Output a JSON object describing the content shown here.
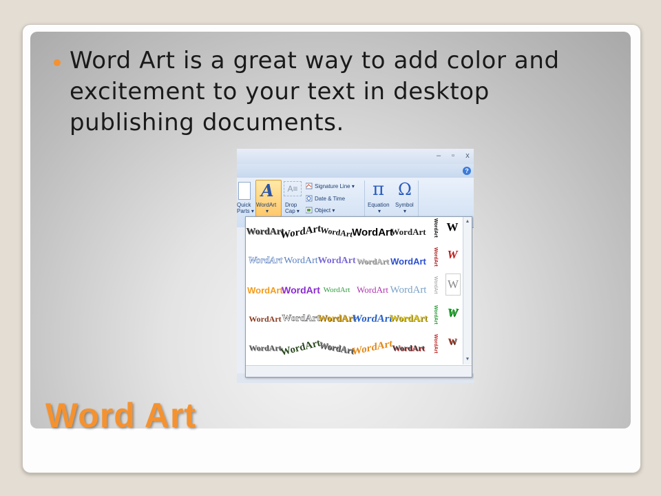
{
  "slide": {
    "bullet_text": "Word Art is a great way to add color and excitement to your text in desktop publishing documents.",
    "title": "Word Art"
  },
  "window": {
    "minimize": "–",
    "restore": "▫",
    "close": "x",
    "help": "?"
  },
  "ribbon": {
    "quick_parts_line1": "Quick",
    "quick_parts_line2": "Parts ▾",
    "wordart_label": "WordArt",
    "wordart_arrow": "▾",
    "wordart_glyph": "A",
    "dropcap_line1": "Drop",
    "dropcap_line2": "Cap ▾",
    "dropcap_glyph": "A≡",
    "signature_line": "Signature Line ▾",
    "date_time": "Date & Time",
    "object": "Object ▾",
    "equation_glyph": "π",
    "equation_label": "Equation",
    "equation_arrow": "▾",
    "symbol_glyph": "Ω",
    "symbol_label": "Symbol",
    "symbol_arrow": "▾"
  },
  "gallery": {
    "sample": "WordArt",
    "vertical_sample": "WordArt",
    "w_sample": "W",
    "scroll_up": "▲",
    "scroll_down": "▼",
    "colors": {
      "blue": "#2a62c9",
      "orange": "#f49b1b",
      "purple": "#8b2bd0",
      "green": "#2f9c3c",
      "gold": "#d6a720",
      "red": "#d22a2a"
    }
  }
}
